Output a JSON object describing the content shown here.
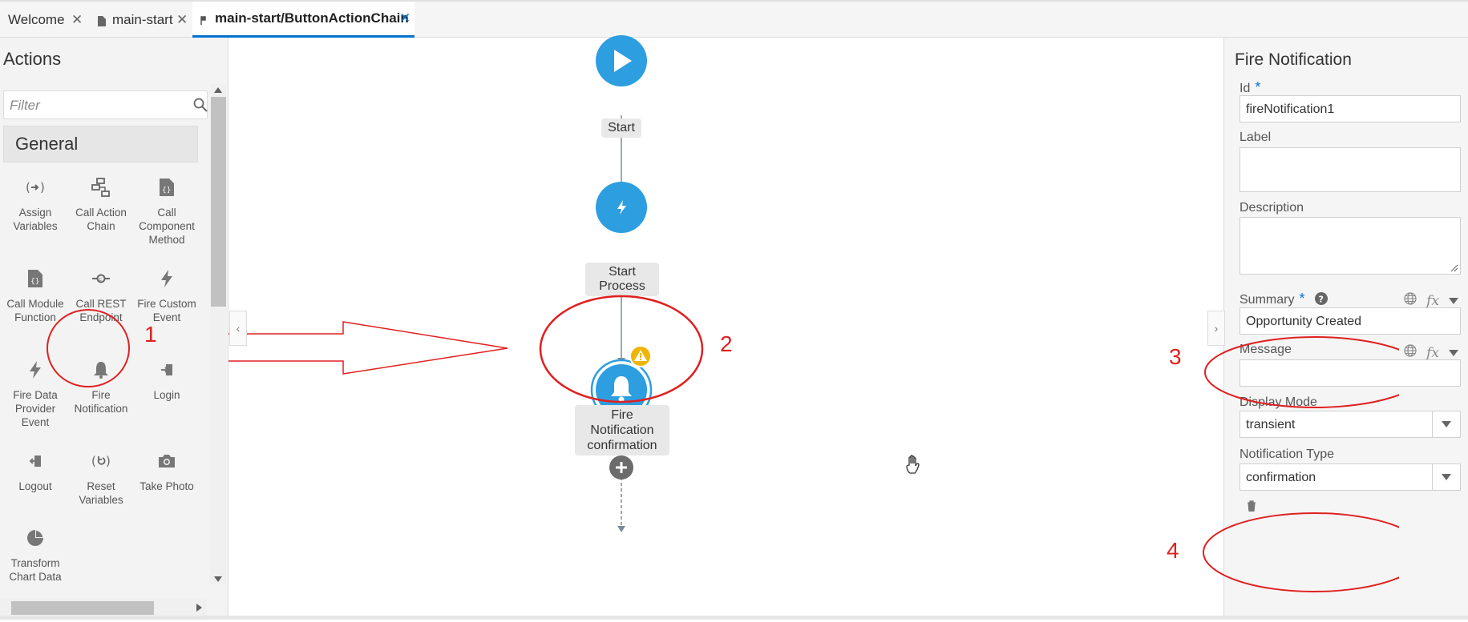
{
  "tabs": [
    {
      "label": "Welcome",
      "active": false,
      "has_icon": false
    },
    {
      "label": "main-start",
      "active": false,
      "has_icon": true
    },
    {
      "label": "main-start/ButtonActionChain",
      "active": true,
      "has_icon": true
    }
  ],
  "left_panel": {
    "title": "Actions",
    "filter_placeholder": "Filter",
    "section": "General",
    "items": [
      {
        "label": "Assign Variables",
        "icon": "assign-variables-icon"
      },
      {
        "label": "Call Action Chain",
        "icon": "call-action-chain-icon"
      },
      {
        "label": "Call Component Method",
        "icon": "call-component-method-icon"
      },
      {
        "label": "Call Module Function",
        "icon": "call-module-function-icon"
      },
      {
        "label": "Call REST Endpoint",
        "icon": "call-rest-endpoint-icon"
      },
      {
        "label": "Fire Custom Event",
        "icon": "lightning-icon"
      },
      {
        "label": "Fire Data Provider Event",
        "icon": "lightning-icon"
      },
      {
        "label": "Fire Notification",
        "icon": "bell-icon"
      },
      {
        "label": "Login",
        "icon": "login-icon"
      },
      {
        "label": "Logout",
        "icon": "logout-icon"
      },
      {
        "label": "Reset Variables",
        "icon": "reset-icon"
      },
      {
        "label": "Take Photo",
        "icon": "camera-icon"
      },
      {
        "label": "Transform Chart Data",
        "icon": "pie-chart-icon"
      }
    ]
  },
  "canvas": {
    "nodes": {
      "start": {
        "label": "Start",
        "icon": "play-icon"
      },
      "start_process": {
        "label": "Start Process",
        "icon": "lightning-icon"
      },
      "fire_notification": {
        "label_line1": "Fire Notification",
        "label_line2": "confirmation",
        "icon": "bell-icon",
        "warning_icon": "warning-icon"
      }
    },
    "add_icon": "plus-icon",
    "cursor_icon": "hand-cursor-icon",
    "colors": {
      "node": "#2d9ee0",
      "edge": "#7a8a99",
      "warning": "#f0b400",
      "add": "#6b6b6b"
    }
  },
  "properties": {
    "title": "Fire Notification",
    "id_label": "Id",
    "id_value": "fireNotification1",
    "label_label": "Label",
    "label_value": "",
    "description_label": "Description",
    "description_value": "",
    "summary_label": "Summary",
    "summary_value": "Opportunity Created",
    "message_label": "Message",
    "message_value": "",
    "display_mode_label": "Display Mode",
    "display_mode_value": "transient",
    "notification_type_label": "Notification Type",
    "notification_type_value": "confirmation",
    "required_mark": "*",
    "fx_label": "fx"
  },
  "annotations": {
    "numbers": [
      "1",
      "2",
      "3",
      "4"
    ],
    "color": "#e02020"
  }
}
